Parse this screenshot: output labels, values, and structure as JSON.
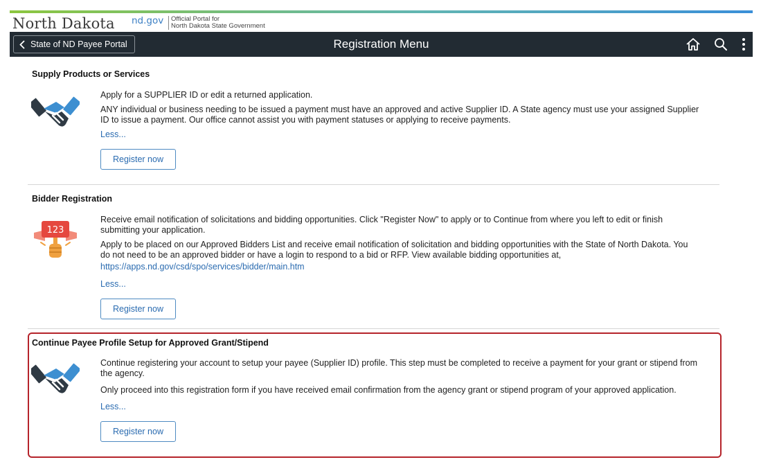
{
  "branding": {
    "state_name": "North Dakota",
    "portal_domain": "nd.gov",
    "tagline_line1": "Official Portal for",
    "tagline_line2": "North Dakota State Government"
  },
  "navbar": {
    "back_label": "State of ND Payee Portal",
    "title": "Registration Menu",
    "icons": [
      "home-icon",
      "search-icon",
      "more-vertical-icon"
    ]
  },
  "sections": {
    "supplier": {
      "title": "Supply Products or Services",
      "paragraph1": "Apply for a SUPPLIER ID or edit a returned application.",
      "paragraph2": "ANY individual or business needing to be issued a payment must have an approved and active Supplier ID. A State agency must use your assigned Supplier ID to issue a payment.  Our office cannot assist you with payment statuses or applying to receive payments.",
      "less_label": "Less...",
      "button_label": "Register now",
      "icon": "handshake-icon"
    },
    "bidder": {
      "title": "Bidder Registration",
      "paragraph1": "Receive email notification of solicitations and bidding opportunities. Click \"Register Now\"  to apply or to Continue from where you left to edit or finish submitting your application.",
      "paragraph2": "Apply to be placed on our Approved Bidders List and receive email notification of solicitation and bidding opportunities with the State of North Dakota.  You do not need to be an approved bidder or have a login to respond to a bid or RFP. View available bidding opportunities at,",
      "link_url_text": "https://apps.nd.gov/csd/spo/services/bidder/main.htm",
      "less_label": "Less...",
      "button_label": "Register now",
      "icon": "auction-paddle-icon",
      "paddle_number": "123"
    },
    "grant": {
      "title": "Continue Payee Profile Setup for Approved Grant/Stipend",
      "paragraph1": "Continue registering your account to setup your payee (Supplier ID) profile. This step must be completed to receive a payment for your grant or stipend from the agency.",
      "paragraph2": "Only proceed into this registration form if you have received email confirmation from the agency grant or stipend program of your approved application.",
      "less_label": "Less...",
      "button_label": "Register now",
      "icon": "handshake-icon"
    }
  },
  "colors": {
    "navbar_bg": "#222b33",
    "link": "#2a6bb0",
    "highlight_border": "#b5232a",
    "handshake_dark": "#2f3a44",
    "handshake_blue": "#3d8fd1",
    "paddle_red": "#e5483f",
    "paddle_orange": "#f0a140"
  }
}
